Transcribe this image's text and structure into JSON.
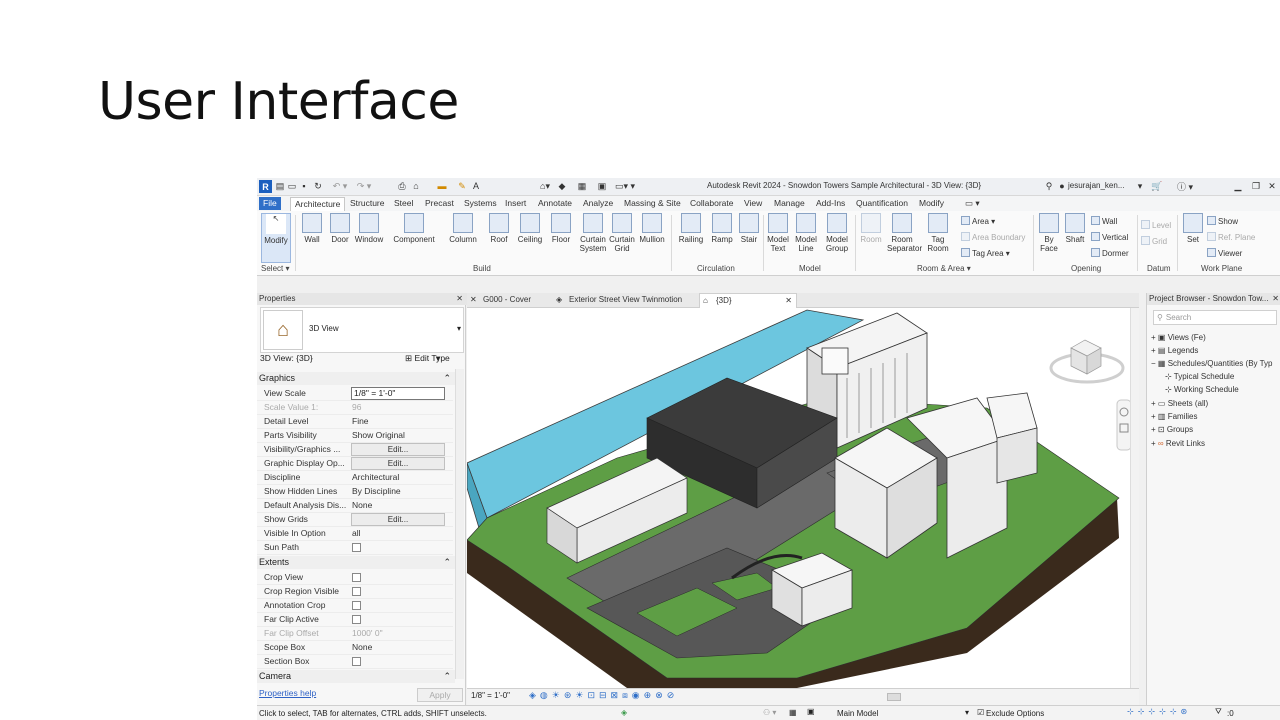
{
  "slide": {
    "title": "User Interface"
  },
  "app": {
    "window_title": "Autodesk Revit 2024 - Snowdon Towers Sample Architectural - 3D View: {3D}",
    "user": "jesurajan_ken...",
    "tabs": [
      "File",
      "Architecture",
      "Structure",
      "Steel",
      "Precast",
      "Systems",
      "Insert",
      "Annotate",
      "Analyze",
      "Massing & Site",
      "Collaborate",
      "View",
      "Manage",
      "Add-Ins",
      "Quantification",
      "Modify"
    ],
    "ribbon": {
      "select_label": "Modify",
      "select_panel": "Select",
      "build": [
        "Wall",
        "Door",
        "Window",
        "Component",
        "Column",
        "Roof",
        "Ceiling",
        "Floor",
        "Curtain System",
        "Curtain Grid",
        "Mullion"
      ],
      "build_panel": "Build",
      "circulation": [
        "Railing",
        "Ramp",
        "Stair"
      ],
      "circulation_panel": "Circulation",
      "model": [
        "Model Text",
        "Model Line",
        "Model Group"
      ],
      "model_panel": "Model",
      "room": [
        "Room",
        "Room Separator",
        "Tag Room"
      ],
      "room_small": [
        "Area",
        "Area Boundary",
        "Tag Area"
      ],
      "room_panel": "Room & Area",
      "opening": [
        "By Face",
        "Shaft"
      ],
      "opening_small": [
        "Wall",
        "Vertical",
        "Dormer"
      ],
      "opening_panel": "Opening",
      "datum_small": [
        "Level",
        "Grid"
      ],
      "datum_panel": "Datum",
      "workplane": [
        "Set"
      ],
      "workplane_small": [
        "Show",
        "Ref. Plane",
        "Viewer"
      ],
      "workplane_panel": "Work Plane"
    },
    "properties": {
      "title": "Properties",
      "type_name": "3D View",
      "selector": "3D View: {3D}",
      "edit_type": "Edit Type",
      "graphics_header": "Graphics",
      "rows": [
        {
          "name": "View Scale",
          "value": "1/8\" = 1'-0\""
        },
        {
          "name": "Scale Value    1:",
          "value": "96"
        },
        {
          "name": "Detail Level",
          "value": "Fine"
        },
        {
          "name": "Parts Visibility",
          "value": "Show Original"
        },
        {
          "name": "Visibility/Graphics ...",
          "value": "Edit..."
        },
        {
          "name": "Graphic Display Op...",
          "value": "Edit..."
        },
        {
          "name": "Discipline",
          "value": "Architectural"
        },
        {
          "name": "Show Hidden Lines",
          "value": "By Discipline"
        },
        {
          "name": "Default Analysis Dis...",
          "value": "None"
        },
        {
          "name": "Show Grids",
          "value": "Edit..."
        },
        {
          "name": "Visible In Option",
          "value": "all"
        },
        {
          "name": "Sun Path",
          "value": ""
        }
      ],
      "extents_header": "Extents",
      "extents_rows": [
        {
          "name": "Crop View",
          "value": ""
        },
        {
          "name": "Crop Region Visible",
          "value": ""
        },
        {
          "name": "Annotation Crop",
          "value": ""
        },
        {
          "name": "Far Clip Active",
          "value": ""
        },
        {
          "name": "Far Clip Offset",
          "value": "1000'  0\""
        },
        {
          "name": "Scope Box",
          "value": "None"
        },
        {
          "name": "Section Box",
          "value": ""
        }
      ],
      "camera_header": "Camera",
      "help_link": "Properties help",
      "apply": "Apply"
    },
    "view_tabs": [
      "G000 - Cover",
      "Exterior Street View Twinmotion",
      "{3D}"
    ],
    "view_scale": "1/8\" = 1'-0\"",
    "browser": {
      "title": "Project Browser - Snowdon Tow...",
      "search": "Search",
      "items": [
        "Views (Fe)",
        "Legends",
        "Schedules/Quantities (By Typ",
        "Typical Schedule",
        "Working Schedule",
        "Sheets (all)",
        "Families",
        "Groups",
        "Revit Links"
      ]
    },
    "status": {
      "hint": "Click to select, TAB for alternates, CTRL adds, SHIFT unselects.",
      "model": "Main Model",
      "exclude": "Exclude Options",
      "zero": ":0"
    },
    "colors": {
      "accent": "#2f6fc8",
      "water": "#6cc6df",
      "grass": "#5e9e45",
      "soil": "#3a2a1c",
      "road": "#5f5f5f"
    }
  }
}
